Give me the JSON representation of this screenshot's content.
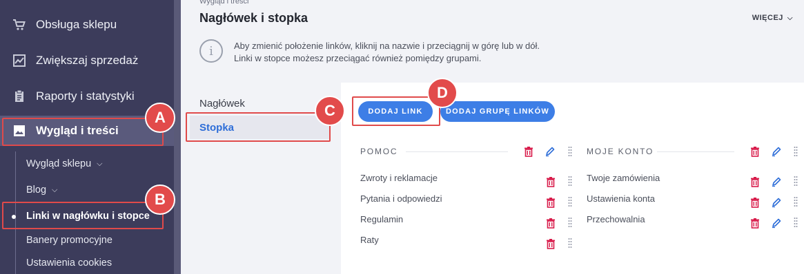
{
  "sidebar": {
    "items": [
      {
        "label": "Obsługa sklepu",
        "icon": "cart-icon"
      },
      {
        "label": "Zwiększaj sprzedaż",
        "icon": "chart-icon"
      },
      {
        "label": "Raporty i statystyki",
        "icon": "clipboard-icon"
      },
      {
        "label": "Wygląd i treści",
        "icon": "image-icon"
      }
    ],
    "subitems": [
      {
        "label": "Wygląd sklepu",
        "chevron": "⌄"
      },
      {
        "label": "Blog",
        "chevron": "⌄"
      },
      {
        "label": "Linki w nagłówku i stopce"
      },
      {
        "label": "Banery promocyjne"
      },
      {
        "label": "Ustawienia cookies"
      }
    ]
  },
  "callouts": [
    "A",
    "B",
    "C",
    "D"
  ],
  "header": {
    "breadcrumb": "Wygląd i treści",
    "title": "Nagłówek i stopka",
    "more": "WIĘCEJ"
  },
  "info": {
    "line1": "Aby zmienić położenie linków, kliknij na nazwie i przeciągnij w górę lub w dół.",
    "line2": "Linki w stopce możesz przeciągać również pomiędzy grupami."
  },
  "tabs": [
    {
      "label": "Nagłówek"
    },
    {
      "label": "Stopka"
    }
  ],
  "buttons": {
    "add_link": "DODAJ LINK",
    "add_group": "DODAJ GRUPĘ LINKÓW"
  },
  "groups": [
    {
      "title": "POMOC",
      "links": [
        "Zwroty i reklamacje",
        "Pytania i odpowiedzi",
        "Regulamin",
        "Raty"
      ]
    },
    {
      "title": "MOJE KONTO",
      "links": [
        "Twoje zamówienia",
        "Ustawienia konta",
        "Przechowalnia"
      ]
    }
  ],
  "colors": {
    "sidebar": "#3c3c5b",
    "accent": "#3d7ee6",
    "callout": "#e24b4b",
    "delete": "#d81b4a"
  }
}
